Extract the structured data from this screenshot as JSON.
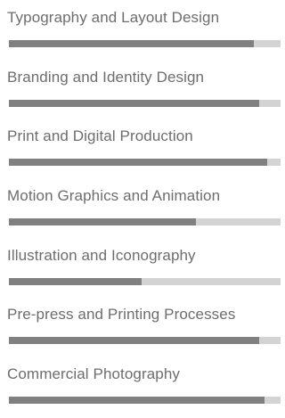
{
  "skills": [
    {
      "label": "Typography and Layout Design",
      "level": 0.9
    },
    {
      "label": "Branding and Identity Design",
      "level": 0.92
    },
    {
      "label": "Print and Digital Production",
      "level": 0.95
    },
    {
      "label": "Motion Graphics and Animation",
      "level": 0.69
    },
    {
      "label": "Illustration and Iconography",
      "level": 0.49
    },
    {
      "label": "Pre-press and Printing Processes",
      "level": 0.92
    },
    {
      "label": "Commercial Photography",
      "level": 0.94
    }
  ],
  "colors": {
    "label": "#6d6d6d",
    "track": "#d3d3d3",
    "fill": "#808080"
  }
}
